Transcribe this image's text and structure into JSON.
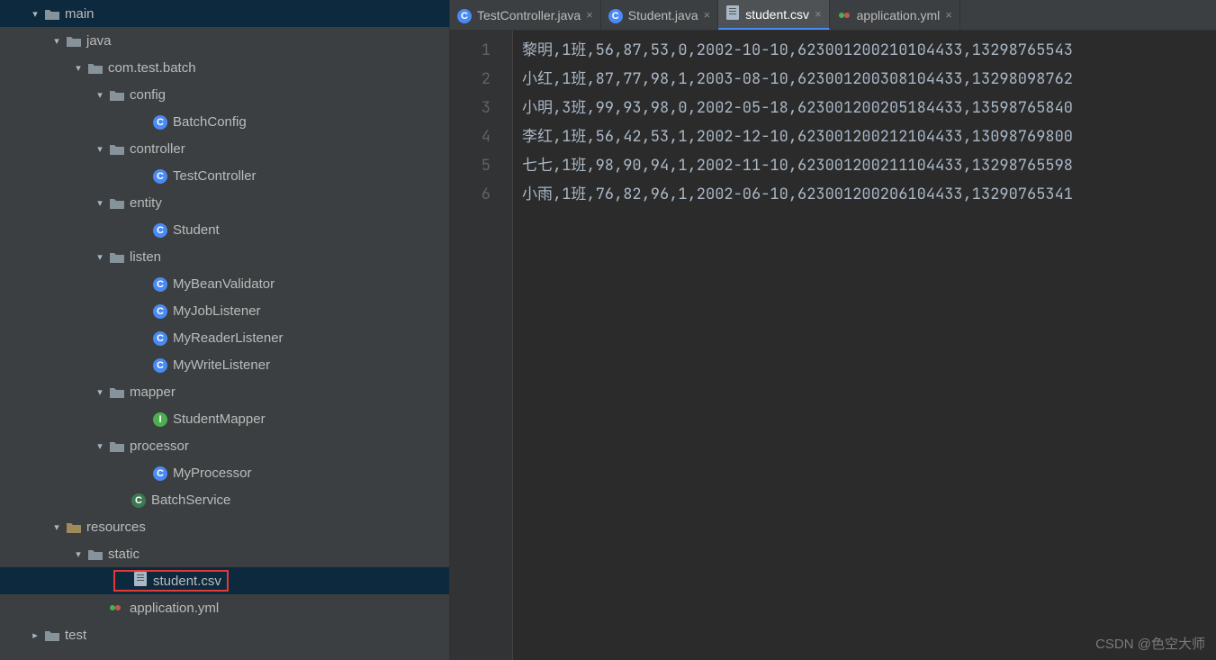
{
  "watermark": "CSDN @色空大师",
  "tabs": [
    {
      "label": "TestController.java",
      "active": false,
      "icon": "class"
    },
    {
      "label": "Student.java",
      "active": false,
      "icon": "class"
    },
    {
      "label": "student.csv",
      "active": true,
      "icon": "file"
    },
    {
      "label": "application.yml",
      "active": false,
      "icon": "yml"
    }
  ],
  "code_lines": [
    "黎明,1班,56,87,53,0,2002-10-10,623001200210104433,13298765543",
    "小红,1班,87,77,98,1,2003-08-10,623001200308104433,13298098762",
    "小明,3班,99,93,98,0,2002-05-18,623001200205184433,13598765840",
    "李红,1班,56,42,53,1,2002-12-10,623001200212104433,13098769800",
    "七七,1班,98,90,94,1,2002-11-10,623001200211104433,13298765598",
    "小雨,1班,76,82,96,1,2002-06-10,623001200206104433,13290765341"
  ],
  "tree": [
    {
      "indent": 30,
      "chev": "v",
      "icon": "folder",
      "label": "main"
    },
    {
      "indent": 54,
      "chev": "v",
      "icon": "folder",
      "label": "java"
    },
    {
      "indent": 78,
      "chev": "v",
      "icon": "folder",
      "label": "com.test.batch"
    },
    {
      "indent": 102,
      "chev": "v",
      "icon": "folder",
      "label": "config"
    },
    {
      "indent": 150,
      "chev": "",
      "icon": "class",
      "label": "BatchConfig"
    },
    {
      "indent": 102,
      "chev": "v",
      "icon": "folder",
      "label": "controller"
    },
    {
      "indent": 150,
      "chev": "",
      "icon": "class",
      "label": "TestController"
    },
    {
      "indent": 102,
      "chev": "v",
      "icon": "folder",
      "label": "entity"
    },
    {
      "indent": 150,
      "chev": "",
      "icon": "class",
      "label": "Student"
    },
    {
      "indent": 102,
      "chev": "v",
      "icon": "folder",
      "label": "listen"
    },
    {
      "indent": 150,
      "chev": "",
      "icon": "class",
      "label": "MyBeanValidator"
    },
    {
      "indent": 150,
      "chev": "",
      "icon": "class",
      "label": "MyJobListener"
    },
    {
      "indent": 150,
      "chev": "",
      "icon": "class",
      "label": "MyReaderListener"
    },
    {
      "indent": 150,
      "chev": "",
      "icon": "class",
      "label": "MyWriteListener"
    },
    {
      "indent": 102,
      "chev": "v",
      "icon": "folder",
      "label": "mapper"
    },
    {
      "indent": 150,
      "chev": "",
      "icon": "interface",
      "label": "StudentMapper"
    },
    {
      "indent": 102,
      "chev": "v",
      "icon": "folder",
      "label": "processor"
    },
    {
      "indent": 150,
      "chev": "",
      "icon": "class",
      "label": "MyProcessor"
    },
    {
      "indent": 126,
      "chev": "",
      "icon": "service",
      "label": "BatchService"
    },
    {
      "indent": 54,
      "chev": "v",
      "icon": "res-folder",
      "label": "resources"
    },
    {
      "indent": 78,
      "chev": "v",
      "icon": "folder",
      "label": "static"
    },
    {
      "indent": 126,
      "chev": "",
      "icon": "file",
      "label": "student.csv",
      "selected": true,
      "highlight": true
    },
    {
      "indent": 102,
      "chev": "",
      "icon": "yml",
      "label": "application.yml"
    },
    {
      "indent": 30,
      "chev": ">",
      "icon": "folder",
      "label": "test"
    }
  ]
}
